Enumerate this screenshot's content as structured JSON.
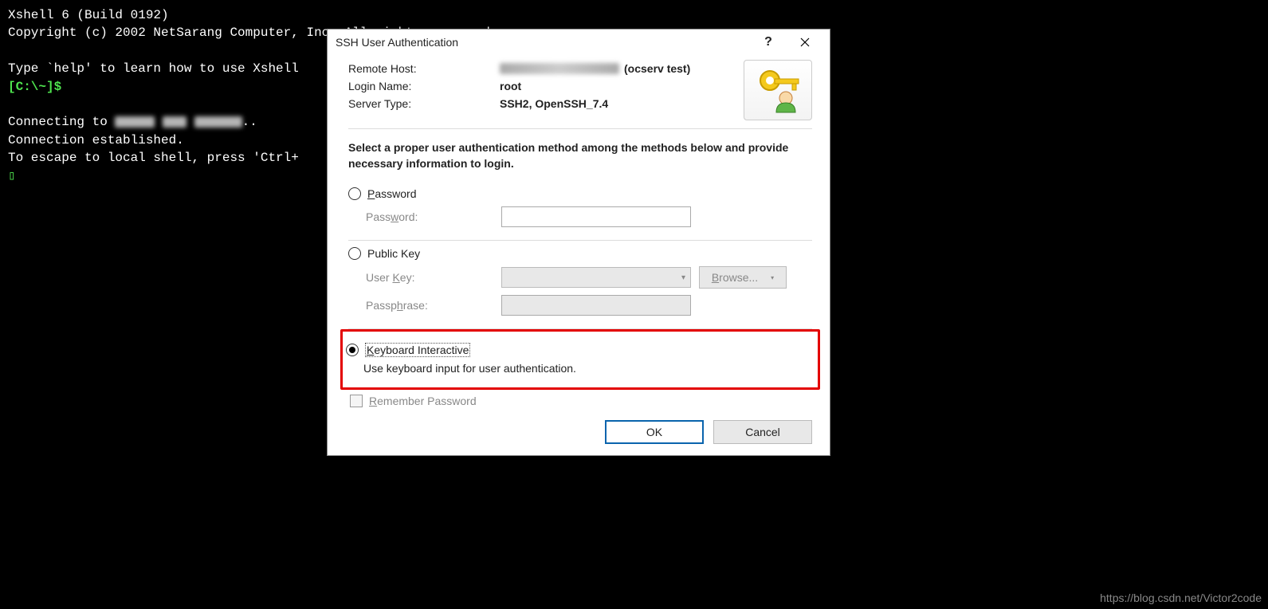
{
  "terminal": {
    "line1": "Xshell 6 (Build 0192)",
    "line2": "Copyright (c) 2002 NetSarang Computer, Inc. All rights reserved.",
    "line3": "",
    "line4": "Type `help' to learn how to use Xshell",
    "prompt": "[C:\\~]$",
    "line6": "",
    "line7_prefix": "Connecting to ",
    "line7_suffix": "..",
    "line8": "Connection established.",
    "line9": "To escape to local shell, press 'Ctrl+",
    "cursor": "▯"
  },
  "dialog": {
    "title": "SSH User Authentication",
    "help": "?",
    "info": {
      "remote_host_label": "Remote Host:",
      "remote_host_suffix": "(ocserv test)",
      "login_name_label": "Login Name:",
      "login_name_value": "root",
      "server_type_label": "Server Type:",
      "server_type_value": "SSH2, OpenSSH_7.4"
    },
    "instruction": "Select a proper user authentication method among the methods below and provide necessary information to login.",
    "auth": {
      "password_label_pre": "",
      "password_label_u": "P",
      "password_label_post": "assword",
      "password_field_label_pre": "Pass",
      "password_field_label_u": "w",
      "password_field_label_post": "ord:",
      "pubkey_label": "Public Key",
      "userkey_label_pre": "User ",
      "userkey_label_u": "K",
      "userkey_label_post": "ey:",
      "passphrase_label_pre": "Passp",
      "passphrase_label_u": "h",
      "passphrase_label_post": "rase:",
      "browse_pre": "",
      "browse_u": "B",
      "browse_post": "rowse...",
      "keyboard_label_u": "K",
      "keyboard_label_post": "eyboard Interactive",
      "keyboard_desc": "Use keyboard input for user authentication."
    },
    "remember_pre": "",
    "remember_u": "R",
    "remember_post": "emember Password",
    "ok": "OK",
    "cancel": "Cancel"
  },
  "watermark": "https://blog.csdn.net/Victor2code"
}
